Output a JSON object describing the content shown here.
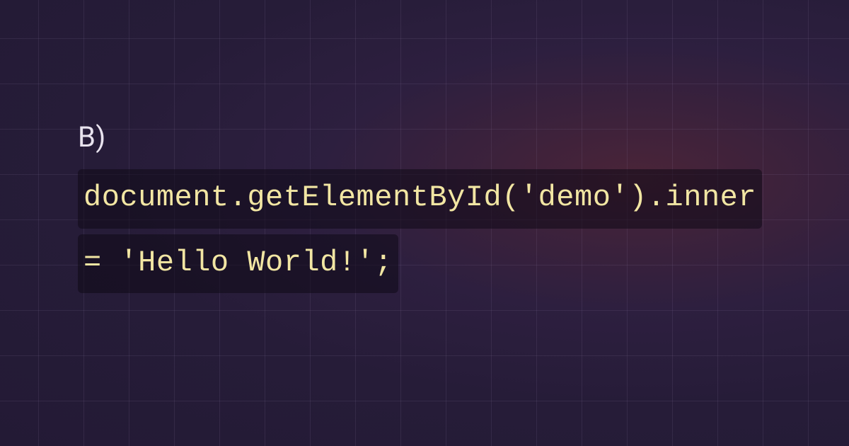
{
  "option": {
    "label": "B)",
    "code_line_1": "document.getElementById('demo').inner",
    "code_line_2": "= 'Hello World!';"
  }
}
